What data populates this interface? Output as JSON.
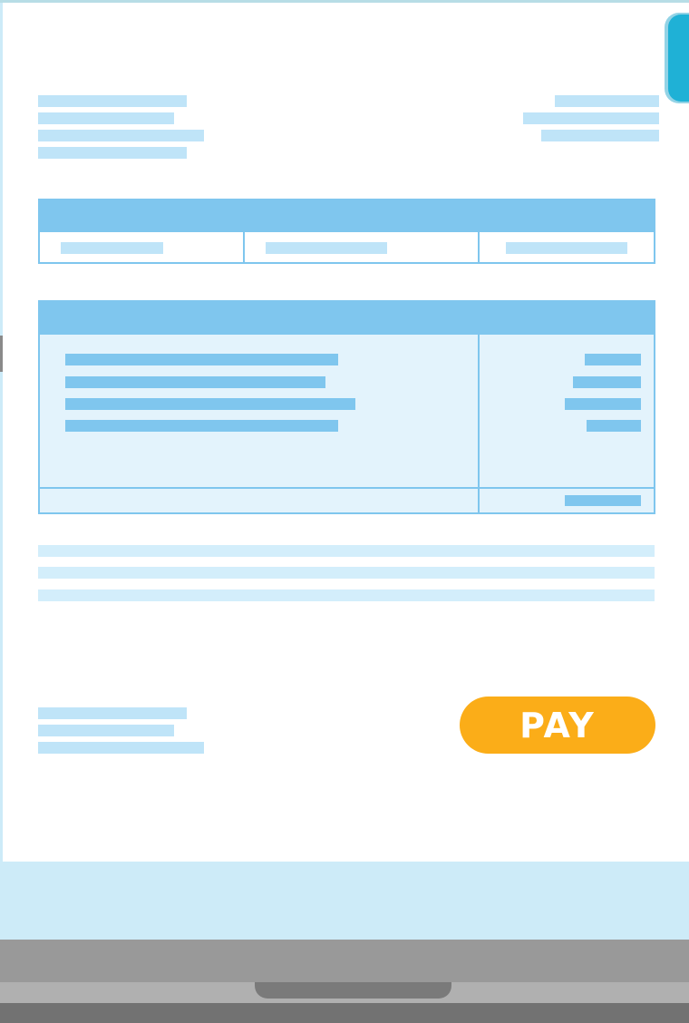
{
  "pay_button": {
    "label": "PAY"
  },
  "colors": {
    "accent": "#7fc6ee",
    "light_bar": "#bfe4f8",
    "table_fill": "#e3f3fc",
    "pay_button": "#fbad18",
    "tab": "#1fb1d6",
    "laptop_base": "#999999"
  },
  "icons": {
    "tab": "side-tab-icon"
  }
}
